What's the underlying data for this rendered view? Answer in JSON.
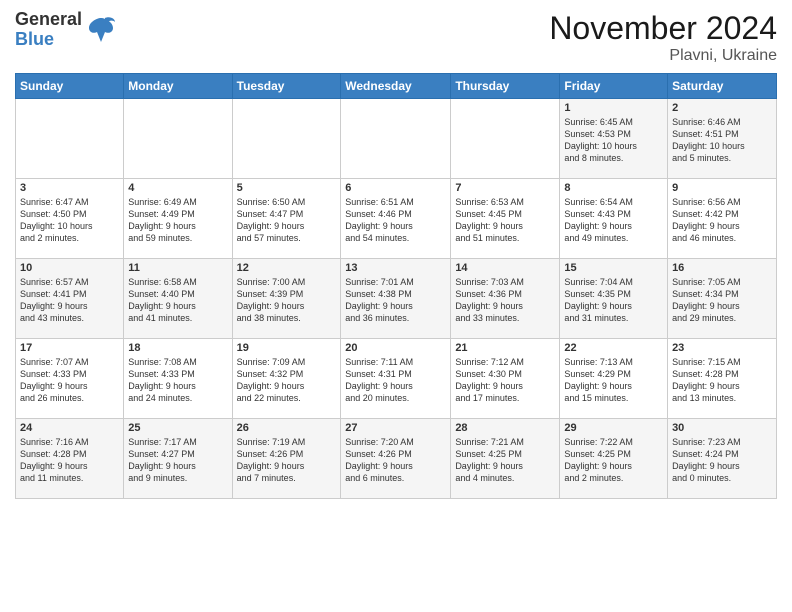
{
  "header": {
    "logo_general": "General",
    "logo_blue": "Blue",
    "month_title": "November 2024",
    "location": "Plavni, Ukraine"
  },
  "weekdays": [
    "Sunday",
    "Monday",
    "Tuesday",
    "Wednesday",
    "Thursday",
    "Friday",
    "Saturday"
  ],
  "weeks": [
    [
      {
        "day": "",
        "info": ""
      },
      {
        "day": "",
        "info": ""
      },
      {
        "day": "",
        "info": ""
      },
      {
        "day": "",
        "info": ""
      },
      {
        "day": "",
        "info": ""
      },
      {
        "day": "1",
        "info": "Sunrise: 6:45 AM\nSunset: 4:53 PM\nDaylight: 10 hours\nand 8 minutes."
      },
      {
        "day": "2",
        "info": "Sunrise: 6:46 AM\nSunset: 4:51 PM\nDaylight: 10 hours\nand 5 minutes."
      }
    ],
    [
      {
        "day": "3",
        "info": "Sunrise: 6:47 AM\nSunset: 4:50 PM\nDaylight: 10 hours\nand 2 minutes."
      },
      {
        "day": "4",
        "info": "Sunrise: 6:49 AM\nSunset: 4:49 PM\nDaylight: 9 hours\nand 59 minutes."
      },
      {
        "day": "5",
        "info": "Sunrise: 6:50 AM\nSunset: 4:47 PM\nDaylight: 9 hours\nand 57 minutes."
      },
      {
        "day": "6",
        "info": "Sunrise: 6:51 AM\nSunset: 4:46 PM\nDaylight: 9 hours\nand 54 minutes."
      },
      {
        "day": "7",
        "info": "Sunrise: 6:53 AM\nSunset: 4:45 PM\nDaylight: 9 hours\nand 51 minutes."
      },
      {
        "day": "8",
        "info": "Sunrise: 6:54 AM\nSunset: 4:43 PM\nDaylight: 9 hours\nand 49 minutes."
      },
      {
        "day": "9",
        "info": "Sunrise: 6:56 AM\nSunset: 4:42 PM\nDaylight: 9 hours\nand 46 minutes."
      }
    ],
    [
      {
        "day": "10",
        "info": "Sunrise: 6:57 AM\nSunset: 4:41 PM\nDaylight: 9 hours\nand 43 minutes."
      },
      {
        "day": "11",
        "info": "Sunrise: 6:58 AM\nSunset: 4:40 PM\nDaylight: 9 hours\nand 41 minutes."
      },
      {
        "day": "12",
        "info": "Sunrise: 7:00 AM\nSunset: 4:39 PM\nDaylight: 9 hours\nand 38 minutes."
      },
      {
        "day": "13",
        "info": "Sunrise: 7:01 AM\nSunset: 4:38 PM\nDaylight: 9 hours\nand 36 minutes."
      },
      {
        "day": "14",
        "info": "Sunrise: 7:03 AM\nSunset: 4:36 PM\nDaylight: 9 hours\nand 33 minutes."
      },
      {
        "day": "15",
        "info": "Sunrise: 7:04 AM\nSunset: 4:35 PM\nDaylight: 9 hours\nand 31 minutes."
      },
      {
        "day": "16",
        "info": "Sunrise: 7:05 AM\nSunset: 4:34 PM\nDaylight: 9 hours\nand 29 minutes."
      }
    ],
    [
      {
        "day": "17",
        "info": "Sunrise: 7:07 AM\nSunset: 4:33 PM\nDaylight: 9 hours\nand 26 minutes."
      },
      {
        "day": "18",
        "info": "Sunrise: 7:08 AM\nSunset: 4:33 PM\nDaylight: 9 hours\nand 24 minutes."
      },
      {
        "day": "19",
        "info": "Sunrise: 7:09 AM\nSunset: 4:32 PM\nDaylight: 9 hours\nand 22 minutes."
      },
      {
        "day": "20",
        "info": "Sunrise: 7:11 AM\nSunset: 4:31 PM\nDaylight: 9 hours\nand 20 minutes."
      },
      {
        "day": "21",
        "info": "Sunrise: 7:12 AM\nSunset: 4:30 PM\nDaylight: 9 hours\nand 17 minutes."
      },
      {
        "day": "22",
        "info": "Sunrise: 7:13 AM\nSunset: 4:29 PM\nDaylight: 9 hours\nand 15 minutes."
      },
      {
        "day": "23",
        "info": "Sunrise: 7:15 AM\nSunset: 4:28 PM\nDaylight: 9 hours\nand 13 minutes."
      }
    ],
    [
      {
        "day": "24",
        "info": "Sunrise: 7:16 AM\nSunset: 4:28 PM\nDaylight: 9 hours\nand 11 minutes."
      },
      {
        "day": "25",
        "info": "Sunrise: 7:17 AM\nSunset: 4:27 PM\nDaylight: 9 hours\nand 9 minutes."
      },
      {
        "day": "26",
        "info": "Sunrise: 7:19 AM\nSunset: 4:26 PM\nDaylight: 9 hours\nand 7 minutes."
      },
      {
        "day": "27",
        "info": "Sunrise: 7:20 AM\nSunset: 4:26 PM\nDaylight: 9 hours\nand 6 minutes."
      },
      {
        "day": "28",
        "info": "Sunrise: 7:21 AM\nSunset: 4:25 PM\nDaylight: 9 hours\nand 4 minutes."
      },
      {
        "day": "29",
        "info": "Sunrise: 7:22 AM\nSunset: 4:25 PM\nDaylight: 9 hours\nand 2 minutes."
      },
      {
        "day": "30",
        "info": "Sunrise: 7:23 AM\nSunset: 4:24 PM\nDaylight: 9 hours\nand 0 minutes."
      }
    ]
  ]
}
